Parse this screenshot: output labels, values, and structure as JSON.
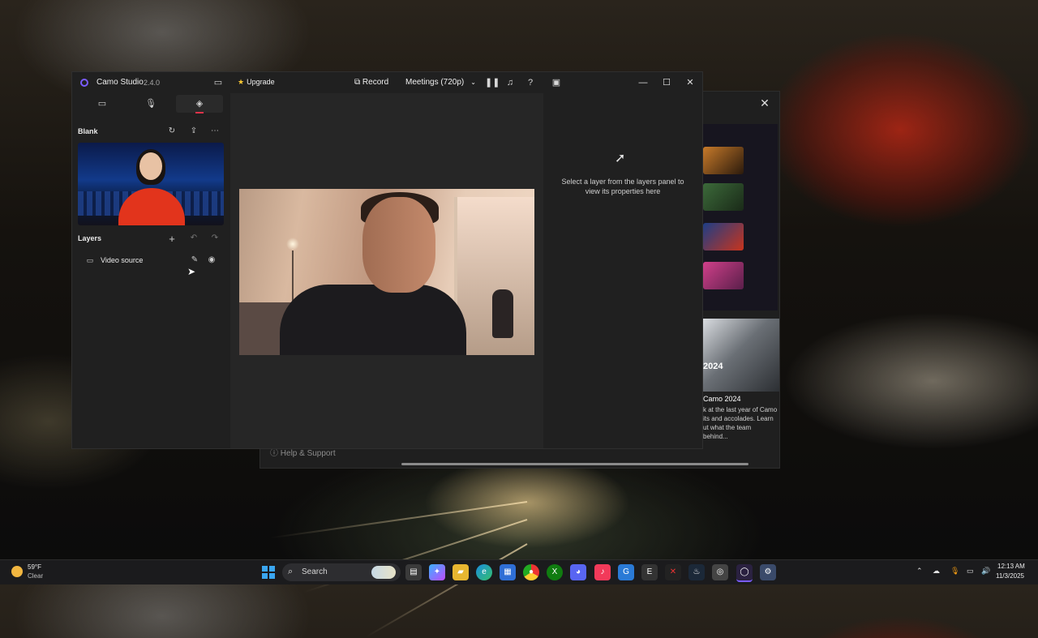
{
  "window": {
    "app_name": "Camo Studio",
    "version": "2.4.0",
    "upgrade_label": "Upgrade",
    "record_label": "Record",
    "preset_label": "Meetings (720p)"
  },
  "scene": {
    "title": "Blank"
  },
  "layers": {
    "title": "Layers",
    "items": [
      {
        "label": "Video source"
      }
    ]
  },
  "properties": {
    "empty_message": "Select a layer from the layers panel to view its properties here"
  },
  "background_window": {
    "promo_year": "2024",
    "promo_title": "Camo 2024",
    "promo_desc": "k at the last year of Camo its and accolades. Learn ut what the team behind...",
    "help_label": "Help & Support"
  },
  "taskbar": {
    "weather_temp": "59°F",
    "weather_condition": "Clear",
    "search_label": "Search",
    "clock_time": "12:13 AM",
    "clock_date": "11/3/2025"
  },
  "colors": {
    "accent": "#7a5cff",
    "active_tab_indicator": "#e0334a",
    "window_bg": "#202020",
    "preview_bg": "#262626"
  }
}
